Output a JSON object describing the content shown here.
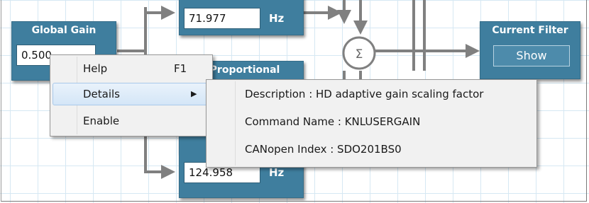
{
  "colors": {
    "block": "#3f7e9e",
    "wire": "#808080",
    "grid": "#d6e8f3",
    "menu": "#f1f1f1"
  },
  "blocks": {
    "global_gain": {
      "title": "Global Gain",
      "value": "0.500"
    },
    "top_frequency": {
      "value": "71.977",
      "unit": "Hz"
    },
    "proportional": {
      "title": "Proportional"
    },
    "bottom_frequency": {
      "value": "124.958",
      "unit": "Hz"
    },
    "summing_junction": {
      "symbol": "Σ"
    },
    "current_filter": {
      "title": "Current Filter",
      "button_label": "Show"
    }
  },
  "context_menu": {
    "items": [
      {
        "label": "Help",
        "shortcut": "F1",
        "icon": "none"
      },
      {
        "label": "Details",
        "icon": "submenu-arrow-icon"
      },
      {
        "label": "Enable",
        "icon": "none"
      }
    ],
    "submenu_arrow": "▶"
  },
  "details_submenu": {
    "items": [
      "Description : HD adaptive gain scaling factor",
      "Command Name : KNLUSERGAIN",
      "CANopen Index : SDO201BS0"
    ]
  }
}
